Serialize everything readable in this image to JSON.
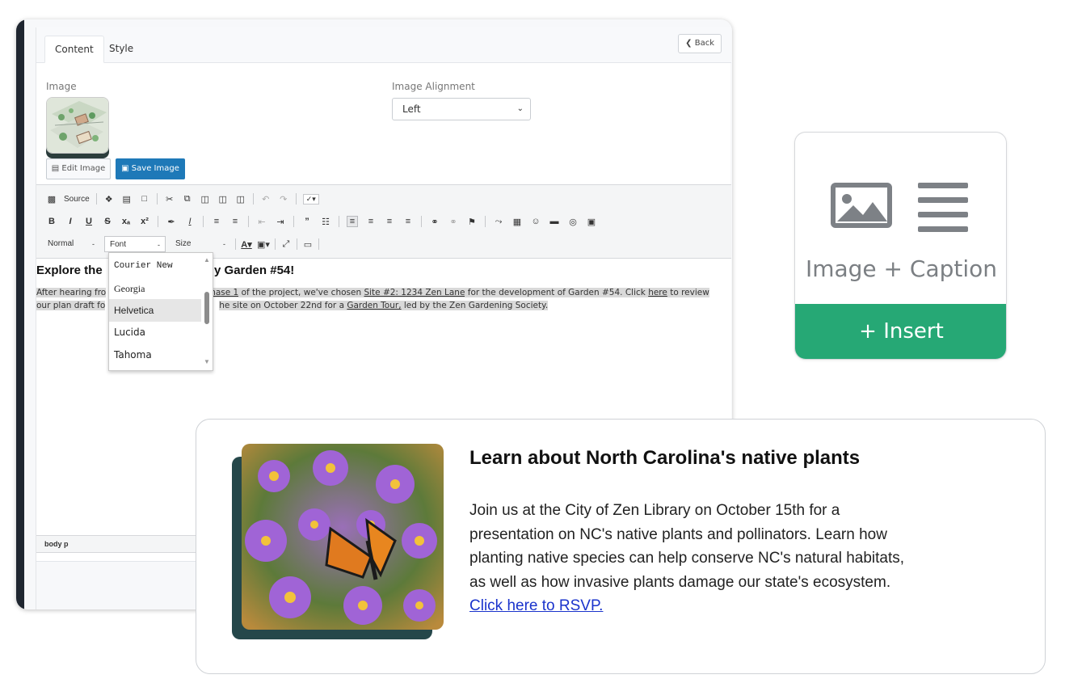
{
  "editor": {
    "tabs": [
      {
        "label": "Content",
        "active": true
      },
      {
        "label": "Style",
        "active": false
      }
    ],
    "back_label": "Back",
    "image_label": "Image",
    "edit_image_label": "Edit Image",
    "save_image_label": "Save Image",
    "image_alignment_label": "Image Alignment",
    "image_alignment_value": "Left",
    "toolbar": {
      "source_label": "Source",
      "format_combo": "Normal",
      "font_combo": "Font",
      "size_combo": "Size"
    },
    "content": {
      "heading_part1": "Explore the",
      "heading_part2": "y Garden #54!",
      "p_line1_a": "After hearing fro",
      "p_line1_link1": "nase 1",
      "p_line1_b": " of the project, we've chosen ",
      "p_line1_link2": "Site #2: 1234 Zen Lane",
      "p_line1_c": " for the development of Garden #54. Click ",
      "p_line1_link3": "here",
      "p_line1_d": " to review",
      "p_line2_a": "our plan draft fo",
      "p_line2_b": "he site on October 22nd for a ",
      "p_line2_link": "Garden Tour,",
      "p_line2_c": " led by the Zen Gardening Society."
    },
    "status_path": "body  p",
    "font_dropdown": {
      "items": [
        "Courier New",
        "Georgia",
        "Helvetica",
        "Lucida",
        "Tahoma"
      ],
      "selected": "Helvetica"
    }
  },
  "widget": {
    "title": "Image + Caption",
    "insert_label": "Insert"
  },
  "preview": {
    "title": "Learn about North Carolina's native plants",
    "body": "Join us at the City of Zen Library on October 15th for a presentation on NC's native plants and pollinators. Learn how planting native species can help conserve NC's natural habitats, as well as how invasive plants damage our state's ecosystem.",
    "link_text": "Click here to RSVP."
  },
  "colors": {
    "save_button": "#1e79b8",
    "insert_bar": "#26a875",
    "link": "#1a33cc",
    "image_shadow": "#25474a"
  }
}
